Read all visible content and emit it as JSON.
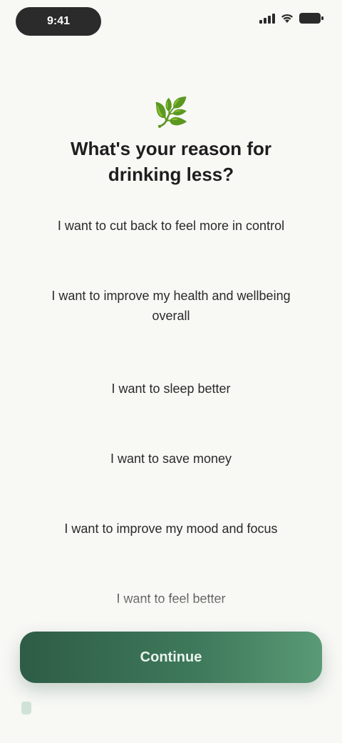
{
  "status_bar": {
    "time": "9:41"
  },
  "header": {
    "emoji": "🌿",
    "title": "What's your reason for drinking less?"
  },
  "options": [
    {
      "label": "I want to cut back to feel more in control"
    },
    {
      "label": "I want to improve my health and wellbeing overall"
    },
    {
      "label": "I want to sleep better"
    },
    {
      "label": "I want to save money"
    },
    {
      "label": "I want to improve my mood and focus"
    },
    {
      "label": "I want to feel better"
    }
  ],
  "footer": {
    "continue_label": "Continue"
  },
  "colors": {
    "background": "#f8f8f5",
    "accent": "#3f7a5c",
    "text": "#1f1f1f"
  }
}
